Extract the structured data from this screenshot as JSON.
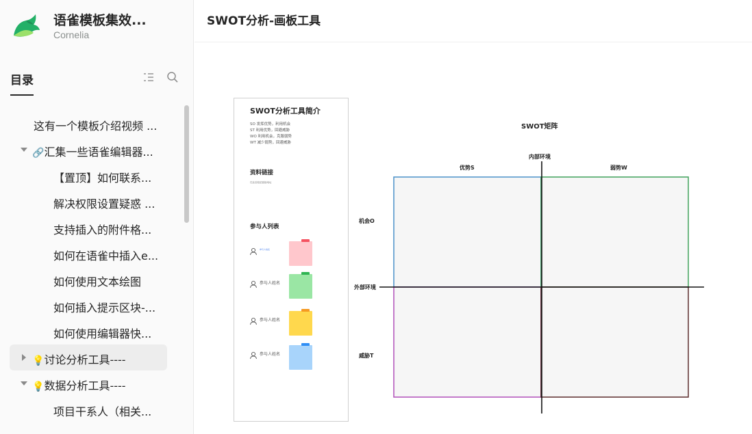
{
  "sidebar": {
    "book_title": "语雀模板集效...",
    "book_owner": "Cornelia",
    "toc_title": "目录",
    "toc_items": [
      {
        "label": "这有一个模板介绍视频 ...",
        "indent": 0,
        "caret": "none",
        "emoji": "",
        "active": false
      },
      {
        "label": "汇集一些语雀编辑器...",
        "indent": 0,
        "caret": "down",
        "emoji": "🔗",
        "active": false
      },
      {
        "label": "【置顶】如何联系...",
        "indent": 1,
        "caret": "none",
        "emoji": "",
        "active": false
      },
      {
        "label": "解决权限设置疑惑 ...",
        "indent": 1,
        "caret": "none",
        "emoji": "",
        "active": false
      },
      {
        "label": "支持插入的附件格...",
        "indent": 1,
        "caret": "none",
        "emoji": "",
        "active": false
      },
      {
        "label": "如何在语雀中插入e...",
        "indent": 1,
        "caret": "none",
        "emoji": "",
        "active": false
      },
      {
        "label": "如何使用文本绘图",
        "indent": 1,
        "caret": "none",
        "emoji": "",
        "active": false
      },
      {
        "label": "如何插入提示区块-...",
        "indent": 1,
        "caret": "none",
        "emoji": "",
        "active": false
      },
      {
        "label": "如何使用编辑器快...",
        "indent": 1,
        "caret": "none",
        "emoji": "",
        "active": false
      },
      {
        "label": "讨论分析工具----",
        "indent": 0,
        "caret": "right",
        "emoji": "💡",
        "active": true
      },
      {
        "label": "数据分析工具----",
        "indent": 0,
        "caret": "down",
        "emoji": "💡",
        "active": false
      },
      {
        "label": "项目干系人（相关...",
        "indent": 1,
        "caret": "none",
        "emoji": "",
        "active": false
      }
    ],
    "icons": {
      "list": "list-outline-icon",
      "search": "search-icon",
      "logo": "yuque-bird-logo"
    }
  },
  "document": {
    "title": "SWOT分析-画板工具"
  },
  "intro_card": {
    "title": "SWOT分析工具简介",
    "lines": [
      "SO 发挥优势，利用机会",
      "ST 利用优势，回避威胁",
      "WO 利用机会，克服弱势",
      "WT 减少弱势，回避威胁"
    ],
    "link_section": "资料链接",
    "link_text": "在此处粘贴链接地址",
    "members_section": "参与人列表",
    "first_member_note": "参与人姓名",
    "member_name": "参与人姓名",
    "sticky_colors": [
      "#ffc7cc",
      "#9ae6a4",
      "#ffd84d",
      "#a8d4fb"
    ],
    "sticky_tab_colors": [
      "#f5515f",
      "#2fb452",
      "#f59a23",
      "#2f8ef5"
    ]
  },
  "swot": {
    "title": "SWOT矩阵",
    "internal_label": "内部环境",
    "external_label": "外部环境",
    "strength_label": "优势S",
    "weakness_label": "弱势W",
    "opportunity_label": "机会O",
    "threat_label": "威胁T",
    "colors": {
      "so": "#4a90c8",
      "wo": "#3ea05a",
      "st": "#b04fb8",
      "wt": "#5a2a2a",
      "fill": "#f6f6f6"
    }
  }
}
